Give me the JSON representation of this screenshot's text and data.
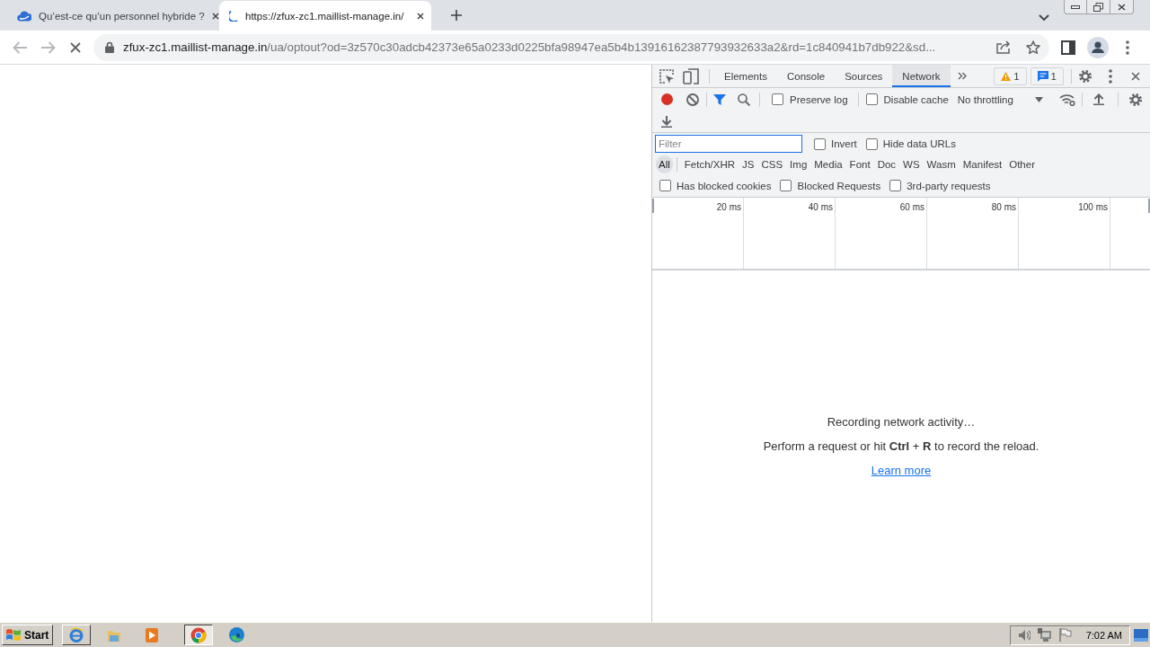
{
  "browser": {
    "tabs": [
      {
        "title": "Qu’est-ce qu’un personnel hybride ?",
        "selected": false,
        "loading": false
      },
      {
        "title": "https://zfux-zc1.maillist-manage.in/",
        "selected": true,
        "loading": true
      }
    ],
    "toolbar": {
      "loading": true
    },
    "address_bar": {
      "host": "zfux-zc1.maillist-manage.in",
      "path": "/ua/optout?od=3z570c30adcb42373e65a0233d0225bfa98947ea5b4b13916162387793932633a2&rd=1c840941b7db922&sd..."
    }
  },
  "devtools": {
    "tabs": [
      {
        "label": "Elements",
        "selected": false
      },
      {
        "label": "Console",
        "selected": false
      },
      {
        "label": "Sources",
        "selected": false
      },
      {
        "label": "Network",
        "selected": true
      }
    ],
    "issues": {
      "warnings": "1",
      "messages": "1"
    },
    "recording": true,
    "filter_shown": true,
    "options": [
      {
        "label": "Preserve log",
        "checked": false
      },
      {
        "label": "Disable cache",
        "checked": false
      }
    ],
    "throttling": "No throttling",
    "filter_input": {
      "placeholder": "Filter"
    },
    "filter_options": [
      {
        "label": "Invert",
        "checked": false
      },
      {
        "label": "Hide data URLs",
        "checked": false
      }
    ],
    "types": [
      {
        "label": "All",
        "selected": true
      },
      {
        "label": "Fetch/XHR",
        "selected": false
      },
      {
        "label": "JS",
        "selected": false
      },
      {
        "label": "CSS",
        "selected": false
      },
      {
        "label": "Img",
        "selected": false
      },
      {
        "label": "Media",
        "selected": false
      },
      {
        "label": "Font",
        "selected": false
      },
      {
        "label": "Doc",
        "selected": false
      },
      {
        "label": "WS",
        "selected": false
      },
      {
        "label": "Wasm",
        "selected": false
      },
      {
        "label": "Manifest",
        "selected": false
      },
      {
        "label": "Other",
        "selected": false
      }
    ],
    "blocked_options": [
      {
        "label": "Has blocked cookies",
        "checked": false
      },
      {
        "label": "Blocked Requests",
        "checked": false
      },
      {
        "label": "3rd-party requests",
        "checked": false
      }
    ],
    "timeline": {
      "ticks": [
        "20 ms",
        "40 ms",
        "60 ms",
        "80 ms",
        "100 ms"
      ]
    },
    "empty_state": {
      "title": "Recording network activity…",
      "hint": "Perform a request or hit **Ctrl** + **R** to record the reload.",
      "link": "Learn more"
    }
  },
  "taskbar": {
    "start": "Start",
    "apps": [
      {
        "kind": "ie",
        "open": true,
        "selected": false
      },
      {
        "kind": "folder",
        "open": false,
        "selected": false
      },
      {
        "kind": "media",
        "open": false,
        "selected": false
      },
      {
        "kind": "chrome",
        "open": true,
        "selected": true
      },
      {
        "kind": "edge",
        "open": false,
        "selected": false
      }
    ],
    "clock": "7:02 AM"
  }
}
